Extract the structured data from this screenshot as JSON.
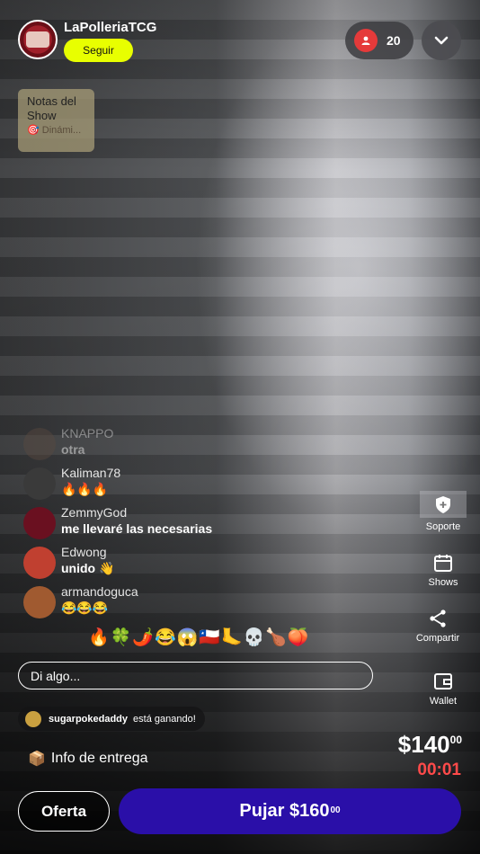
{
  "header": {
    "seller_name": "LaPolleriaTCG",
    "follow_label": "Seguir",
    "viewer_count": "20"
  },
  "notes": {
    "title": "Notas del Show",
    "subtitle": "🎯 Dinámi..."
  },
  "chat": [
    {
      "user": "KNAPPO",
      "text": "otra",
      "avatar_color": "#5a4a40"
    },
    {
      "user": "Kaliman78",
      "text": "🔥🔥🔥",
      "avatar_color": "#3a3a3a"
    },
    {
      "user": "ZemmyGod",
      "text": "me llevaré las necesarias",
      "avatar_color": "#6a1020"
    },
    {
      "user": "Edwong",
      "text": "unido 👋",
      "avatar_color": "#c04030"
    },
    {
      "user": "armandoguca",
      "text": "😂😂😂",
      "avatar_color": "#a05a30"
    }
  ],
  "emoji_bar": "🔥🍀🌶️😂😱🇨🇱🦶💀🍗🍑",
  "input": {
    "placeholder": "Di algo..."
  },
  "winner": {
    "name": "sugarpokedaddy",
    "status": "está ganando!"
  },
  "delivery_label": "Info de entrega",
  "auction": {
    "price_main": "$140",
    "price_cents": "00",
    "timer": "00:01"
  },
  "side_actions": {
    "support": "Soporte",
    "shows": "Shows",
    "share": "Compartir",
    "wallet": "Wallet"
  },
  "buttons": {
    "offer": "Oferta",
    "bid_main": "Pujar $160",
    "bid_cents": "00"
  },
  "colors": {
    "follow": "#e8ff00",
    "bid": "#2a0fa8",
    "timer": "#ff4a4a",
    "viewer_badge": "#e53a3a"
  }
}
